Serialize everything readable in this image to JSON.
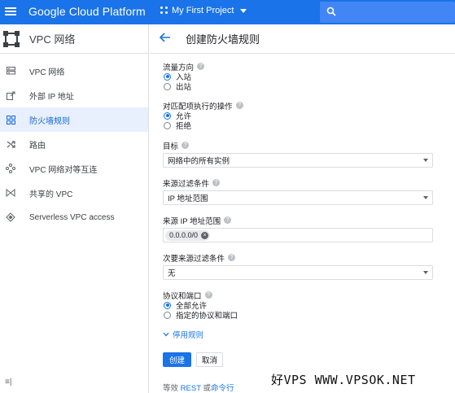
{
  "header": {
    "brand": "Google Cloud Platform",
    "project": "My First Project",
    "accent": "#1a73e8"
  },
  "sidebar": {
    "title": "VPC 网络",
    "items": [
      {
        "label": "VPC 网络",
        "icon": "vpc-network-icon"
      },
      {
        "label": "外部 IP 地址",
        "icon": "external-ip-icon"
      },
      {
        "label": "防火墙规则",
        "icon": "firewall-icon",
        "active": true
      },
      {
        "label": "路由",
        "icon": "routes-icon"
      },
      {
        "label": "VPC 网络对等互连",
        "icon": "peering-icon"
      },
      {
        "label": "共享的 VPC",
        "icon": "shared-vpc-icon"
      },
      {
        "label": "Serverless VPC access",
        "icon": "serverless-icon"
      }
    ],
    "collapse_glyph": "≡|"
  },
  "page": {
    "title": "创建防火墙规则"
  },
  "form": {
    "direction": {
      "label": "流量方向",
      "options": [
        "入站",
        "出站"
      ],
      "selected": 0
    },
    "action": {
      "label": "对匹配项执行的操作",
      "options": [
        "允许",
        "拒绝"
      ],
      "selected": 0
    },
    "target": {
      "label": "目标",
      "value": "网络中的所有实例"
    },
    "source_filter": {
      "label": "来源过滤条件",
      "value": "IP 地址范围"
    },
    "source_ranges": {
      "label": "来源 IP 地址范围",
      "chip": "0.0.0.0/0"
    },
    "second_filter": {
      "label": "次要来源过滤条件",
      "value": "无"
    },
    "protocols": {
      "label": "协议和端口",
      "options": [
        "全部允许",
        "指定的协议和端口"
      ],
      "selected": 0
    },
    "disable_rule": "停用规则",
    "create_label": "创建",
    "cancel_label": "取消",
    "equivalent_prefix": "等效",
    "rest_link": "REST",
    "or_text": "或",
    "cmd_link": "命令行"
  },
  "watermark": "好VPS WWW.VPSOK.NET"
}
